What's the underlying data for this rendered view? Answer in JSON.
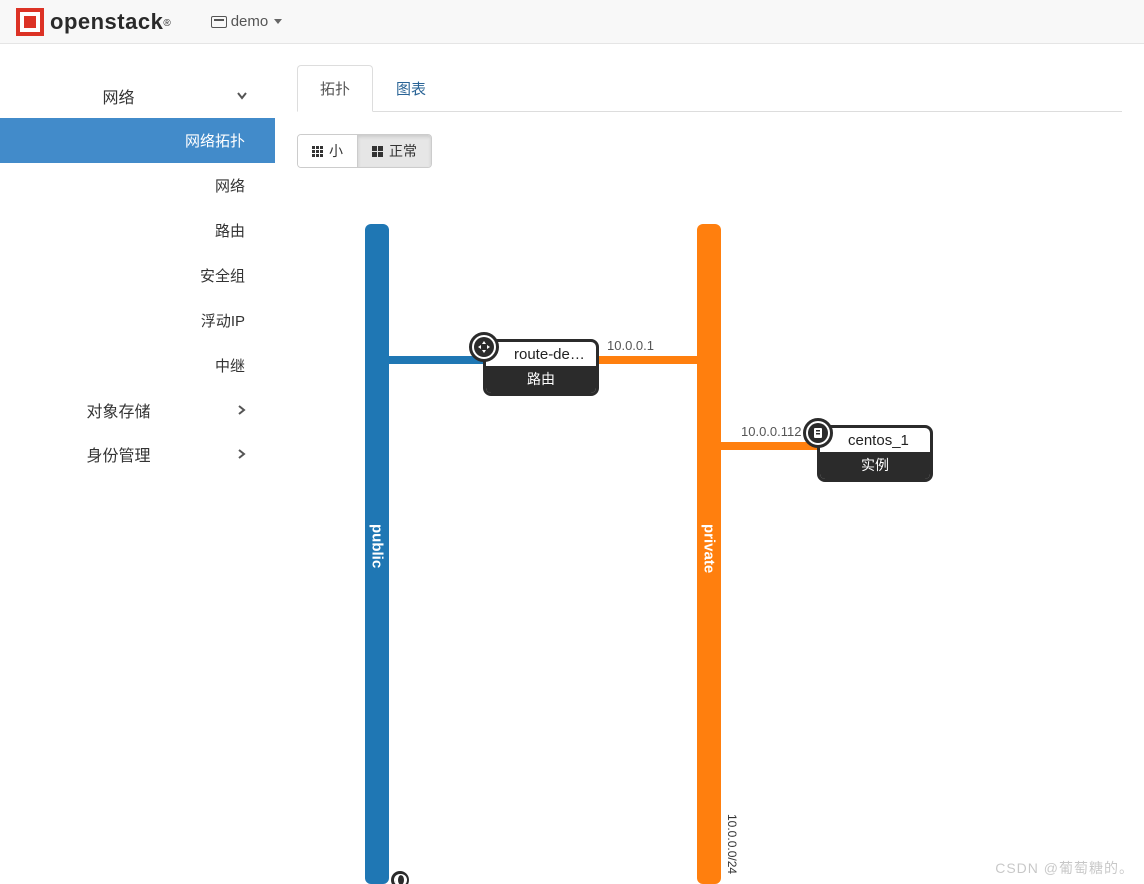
{
  "header": {
    "brand": "openstack",
    "project_label": "demo"
  },
  "sidebar": {
    "network": {
      "label": "网络",
      "items": {
        "topology": "网络拓扑",
        "network": "网络",
        "router": "路由",
        "secgroup": "安全组",
        "floatingip": "浮动IP",
        "trunk": "中继"
      }
    },
    "object_storage": {
      "label": "对象存储"
    },
    "identity": {
      "label": "身份管理"
    }
  },
  "tabs": {
    "topology": "拓扑",
    "graph": "图表"
  },
  "size_switch": {
    "small": "小",
    "normal": "正常"
  },
  "topology": {
    "networks": {
      "public": {
        "label": "public"
      },
      "private": {
        "label": "private",
        "cidr": "10.0.0.0/24"
      }
    },
    "router": {
      "name": "route-dem..",
      "type_label": "路由",
      "private_ip": "10.0.0.1"
    },
    "instance": {
      "name": "centos_1",
      "type_label": "实例",
      "private_ip": "10.0.0.112"
    }
  },
  "watermark": "CSDN @葡萄糖的。"
}
